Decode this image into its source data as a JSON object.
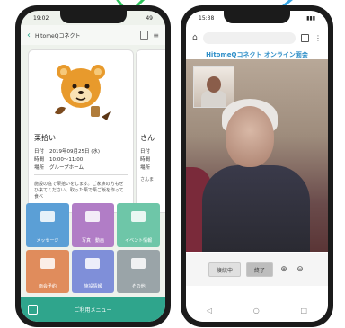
{
  "left_phone": {
    "status_time": "19:02",
    "status_right": "49",
    "app": {
      "back_glyph": "‹",
      "title": "HitomeQコネクト"
    },
    "card": {
      "title": "栗拾い",
      "rows": [
        {
          "label": "日付",
          "value": "2019年09月25日 (水)"
        },
        {
          "label": "時間",
          "value": "10:00〜11:00"
        },
        {
          "label": "場所",
          "value": "グループホーム"
        }
      ],
      "description": "施設の庭で栗拾いをします。ご家族の方もぜひ来てください。取った栗で栗ご飯を作って食べ"
    },
    "next_card": {
      "title": "さん",
      "rows": [
        "日付",
        "時間",
        "場所"
      ],
      "description": "さんま"
    },
    "menu": [
      {
        "label": "メッセージ",
        "color": "#5b9fd6"
      },
      {
        "label": "写真・動画",
        "color": "#b17dc6"
      },
      {
        "label": "イベント情報",
        "color": "#6ec6a8"
      },
      {
        "label": "面会予約",
        "color": "#e08c5c"
      },
      {
        "label": "施設情報",
        "color": "#7f8fd9"
      },
      {
        "label": "その他",
        "color": "#9aa4a8"
      }
    ],
    "bottom_label": "ご利用メニュー"
  },
  "right_phone": {
    "status_time": "15:38",
    "page_title": "HitomeQコネクト オンライン面会",
    "controls": {
      "status_label": "接続中",
      "end_label": "終了",
      "zoom_in": "⊕",
      "zoom_out": "⊖"
    },
    "nav": {
      "back": "◁",
      "home": "○",
      "recent": "□"
    }
  },
  "colors": {
    "accent_green": "#2fa58c",
    "accent_blue": "#2f8fc8",
    "check_green": "#2ec45c",
    "check_blue": "#3aa7e6"
  }
}
